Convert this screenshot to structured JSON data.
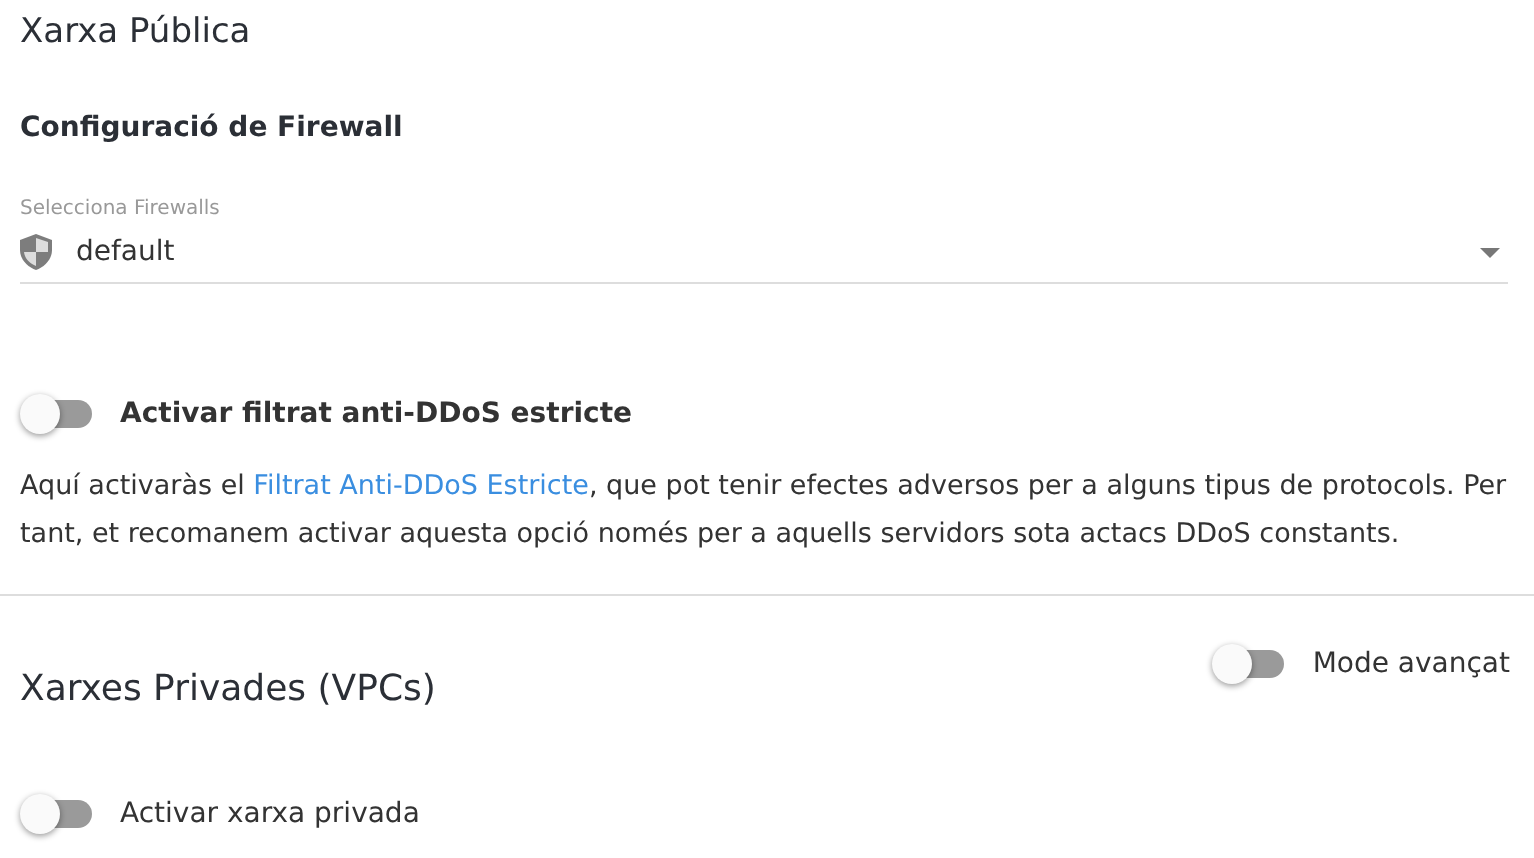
{
  "public_network": {
    "title": "Xarxa Pública",
    "firewall_heading": "Configuració de Firewall",
    "firewall_select": {
      "label": "Selecciona Firewalls",
      "value": "default"
    },
    "ddos_toggle": {
      "label": "Activar filtrat anti-DDoS estricte",
      "on": false
    },
    "description": {
      "before": "Aquí activaràs el ",
      "link": "Filtrat Anti-DDoS Estricte",
      "after": ", que pot tenir efectes adversos per a alguns tipus de protocols. Per tant, et recomanem activar aquesta opció només per a aquells servidors sota actacs DDoS constants."
    }
  },
  "private_networks": {
    "title": "Xarxes Privades (VPCs)",
    "advanced_toggle": {
      "label": "Mode avançat",
      "on": false
    },
    "private_toggle": {
      "label": "Activar xarxa privada",
      "on": false
    }
  }
}
